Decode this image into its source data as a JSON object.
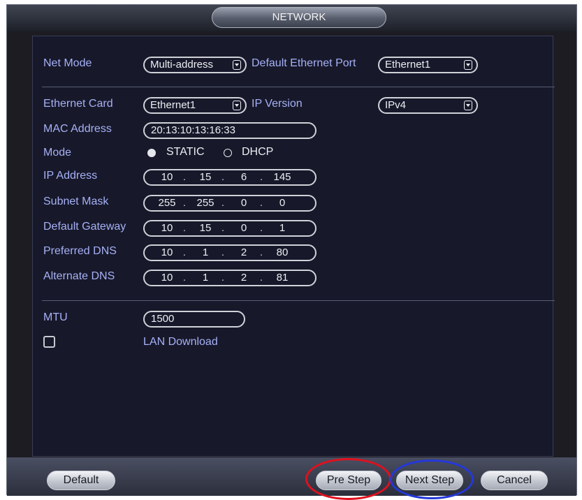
{
  "window": {
    "title": "NETWORK"
  },
  "net_mode": {
    "label": "Net Mode",
    "value": "Multi-address"
  },
  "default_ethernet_port": {
    "label": "Default Ethernet Port",
    "value": "Ethernet1"
  },
  "ethernet_card": {
    "label": "Ethernet Card",
    "value": "Ethernet1"
  },
  "ip_version": {
    "label": "IP Version",
    "value": "IPv4"
  },
  "mac_address": {
    "label": "MAC Address",
    "value": "20:13:10:13:16:33"
  },
  "mode": {
    "label": "Mode",
    "options": [
      "STATIC",
      "DHCP"
    ],
    "selected": "STATIC"
  },
  "ip_address": {
    "label": "IP Address",
    "octets": [
      "10",
      "15",
      "6",
      "145"
    ]
  },
  "subnet_mask": {
    "label": "Subnet Mask",
    "octets": [
      "255",
      "255",
      "0",
      "0"
    ]
  },
  "default_gateway": {
    "label": "Default Gateway",
    "octets": [
      "10",
      "15",
      "0",
      "1"
    ]
  },
  "preferred_dns": {
    "label": "Preferred DNS",
    "octets": [
      "10",
      "1",
      "2",
      "80"
    ]
  },
  "alternate_dns": {
    "label": "Alternate DNS",
    "octets": [
      "10",
      "1",
      "2",
      "81"
    ]
  },
  "mtu": {
    "label": "MTU",
    "value": "1500"
  },
  "lan_download": {
    "label": "LAN Download",
    "checked": false
  },
  "buttons": {
    "default": "Default",
    "pre_step": "Pre Step",
    "next_step": "Next Step",
    "cancel": "Cancel"
  },
  "highlights": {
    "pre_step_color": "#e0101e",
    "next_step_color": "#2438d8"
  }
}
